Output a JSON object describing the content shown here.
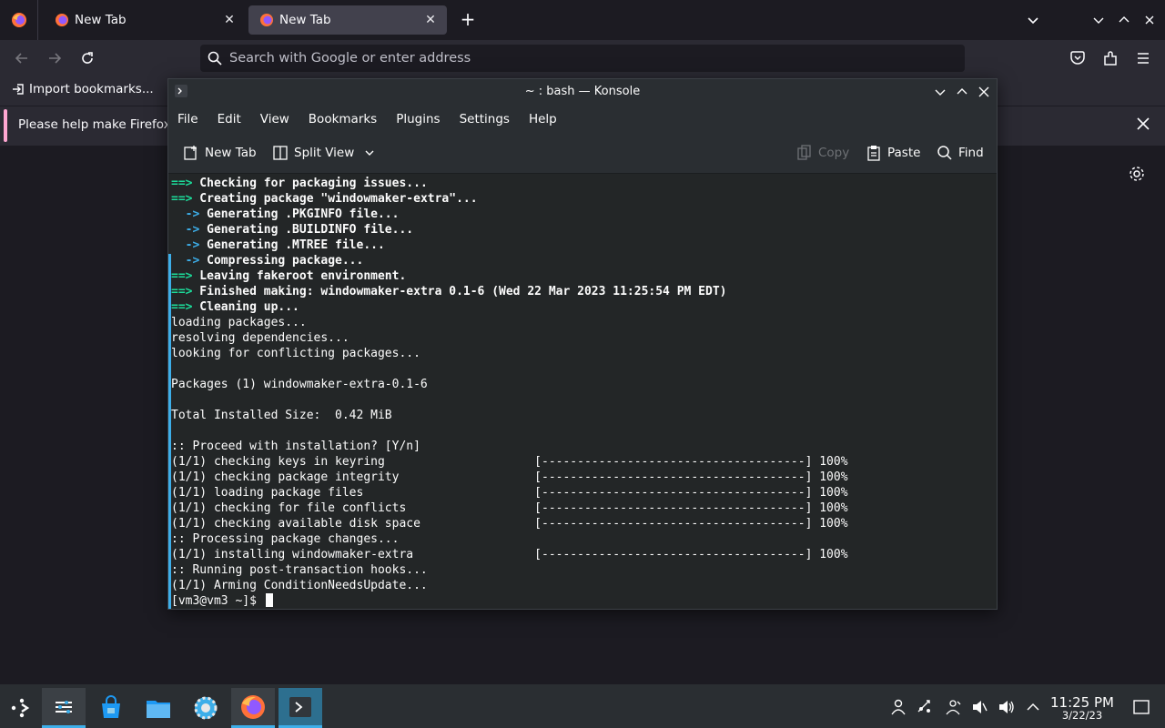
{
  "firefox": {
    "tabs": [
      {
        "label": "New Tab"
      },
      {
        "label": "New Tab"
      }
    ],
    "urlbar": {
      "placeholder": "Search with Google or enter address"
    },
    "bookmarks": {
      "import_label": "Import bookmarks..."
    },
    "notification": {
      "text": "Please help make Firefox b"
    }
  },
  "konsole": {
    "title": "~ : bash — Konsole",
    "menu": [
      "File",
      "Edit",
      "View",
      "Bookmarks",
      "Plugins",
      "Settings",
      "Help"
    ],
    "toolbar": {
      "new_tab": "New Tab",
      "split_view": "Split View",
      "copy": "Copy",
      "paste": "Paste",
      "find": "Find"
    },
    "terminal_lines": [
      {
        "prefix": "==>",
        "prefix_color": "green",
        "text": " Checking for packaging issues...",
        "bold": true
      },
      {
        "prefix": "==>",
        "prefix_color": "green",
        "text": " Creating package \"windowmaker-extra\"...",
        "bold": true
      },
      {
        "prefix": "  ->",
        "prefix_color": "blue",
        "text": " Generating .PKGINFO file...",
        "bold": true
      },
      {
        "prefix": "  ->",
        "prefix_color": "blue",
        "text": " Generating .BUILDINFO file...",
        "bold": true
      },
      {
        "prefix": "  ->",
        "prefix_color": "blue",
        "text": " Generating .MTREE file...",
        "bold": true
      },
      {
        "prefix": "  ->",
        "prefix_color": "blue",
        "text": " Compressing package...",
        "bold": true
      },
      {
        "prefix": "==>",
        "prefix_color": "green",
        "text": " Leaving fakeroot environment.",
        "bold": true
      },
      {
        "prefix": "==>",
        "prefix_color": "green",
        "text": " Finished making: windowmaker-extra 0.1-6 (Wed 22 Mar 2023 11:25:54 PM EDT)",
        "bold": true
      },
      {
        "prefix": "==>",
        "prefix_color": "green",
        "text": " Cleaning up...",
        "bold": true
      },
      {
        "prefix": "",
        "text": "loading packages..."
      },
      {
        "prefix": "",
        "text": "resolving dependencies..."
      },
      {
        "prefix": "",
        "text": "looking for conflicting packages..."
      },
      {
        "prefix": "",
        "text": ""
      },
      {
        "prefix": "",
        "text": "Packages (1) windowmaker-extra-0.1-6"
      },
      {
        "prefix": "",
        "text": ""
      },
      {
        "prefix": "",
        "text": "Total Installed Size:  0.42 MiB"
      },
      {
        "prefix": "",
        "text": ""
      },
      {
        "prefix": "",
        "text": ":: Proceed with installation? [Y/n]"
      },
      {
        "prefix": "",
        "text": "(1/1) checking keys in keyring                     [-------------------------------------] 100%"
      },
      {
        "prefix": "",
        "text": "(1/1) checking package integrity                   [-------------------------------------] 100%"
      },
      {
        "prefix": "",
        "text": "(1/1) loading package files                        [-------------------------------------] 100%"
      },
      {
        "prefix": "",
        "text": "(1/1) checking for file conflicts                  [-------------------------------------] 100%"
      },
      {
        "prefix": "",
        "text": "(1/1) checking available disk space                [-------------------------------------] 100%"
      },
      {
        "prefix": "",
        "text": ":: Processing package changes..."
      },
      {
        "prefix": "",
        "text": "(1/1) installing windowmaker-extra                 [-------------------------------------] 100%"
      },
      {
        "prefix": "",
        "text": ":: Running post-transaction hooks..."
      },
      {
        "prefix": "",
        "text": "(1/1) Arming ConditionNeedsUpdate..."
      }
    ],
    "prompt": "[vm3@vm3 ~]$ "
  },
  "taskbar": {
    "apps": [
      "application-launcher-icon",
      "overview-icon",
      "discover-store-icon",
      "dolphin-files-icon",
      "system-settings-icon",
      "firefox-icon",
      "konsole-icon"
    ],
    "clock": {
      "time": "11:25 PM",
      "date": "3/22/23"
    }
  },
  "colors": {
    "accent": "#3daee9",
    "prompt_arrow_green": "#1cdc9a",
    "notification_accent": "#ffa7d2"
  }
}
